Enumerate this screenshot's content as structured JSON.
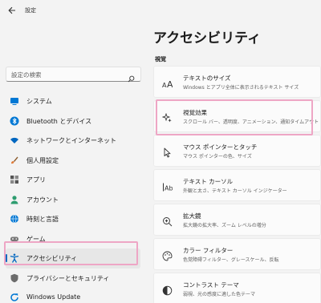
{
  "app": {
    "title": "設定"
  },
  "search": {
    "placeholder": "設定の検索"
  },
  "sidebar": {
    "items": [
      {
        "label": "システム",
        "icon": "monitor-icon",
        "color": "#0078d4"
      },
      {
        "label": "Bluetooth とデバイス",
        "icon": "bluetooth-icon",
        "color": "#0078d4"
      },
      {
        "label": "ネットワークとインターネット",
        "icon": "wifi-icon",
        "color": "#0067c0"
      },
      {
        "label": "個人用設定",
        "icon": "brush-icon",
        "color": "#e07b39"
      },
      {
        "label": "アプリ",
        "icon": "apps-icon",
        "color": "#555555"
      },
      {
        "label": "アカウント",
        "icon": "account-icon",
        "color": "#2d9c6f"
      },
      {
        "label": "時刻と言語",
        "icon": "globe-clock-icon",
        "color": "#0078d4"
      },
      {
        "label": "ゲーム",
        "icon": "gamepad-icon",
        "color": "#777777"
      },
      {
        "label": "アクセシビリティ",
        "icon": "accessibility-icon",
        "color": "#0067c0",
        "selected": true
      },
      {
        "label": "プライバシーとセキュリティ",
        "icon": "shield-icon",
        "color": "#6b6b6b"
      },
      {
        "label": "Windows Update",
        "icon": "update-icon",
        "color": "#0078d4"
      }
    ]
  },
  "main": {
    "title": "アクセシビリティ",
    "section": "視覚",
    "cards": [
      {
        "title": "テキストのサイズ",
        "desc": "Windows とアプリ全体に表示されるテキスト サイズ",
        "icon": "text-size-icon"
      },
      {
        "title": "視覚効果",
        "desc": "スクロール バー、透明度、アニメーション、通知タイムアウト",
        "icon": "sparkle-icon"
      },
      {
        "title": "マウス ポインターとタッチ",
        "desc": "マウス ポインターの色、サイズ",
        "icon": "pointer-icon"
      },
      {
        "title": "テキスト カーソル",
        "desc": "外観と太さ、テキスト カーソル インジケーター",
        "icon": "text-cursor-icon"
      },
      {
        "title": "拡大鏡",
        "desc": "拡大鏡の拡大率、ズーム レベルの増分",
        "icon": "magnifier-icon"
      },
      {
        "title": "カラー フィルター",
        "desc": "色覚障碍フィルター、グレースケール、反転",
        "icon": "palette-icon"
      },
      {
        "title": "コントラスト テーマ",
        "desc": "弱視、光の感度に適した色テーマ",
        "icon": "contrast-icon"
      }
    ]
  },
  "accent": "#0067c0",
  "highlight": "#eea6c5"
}
